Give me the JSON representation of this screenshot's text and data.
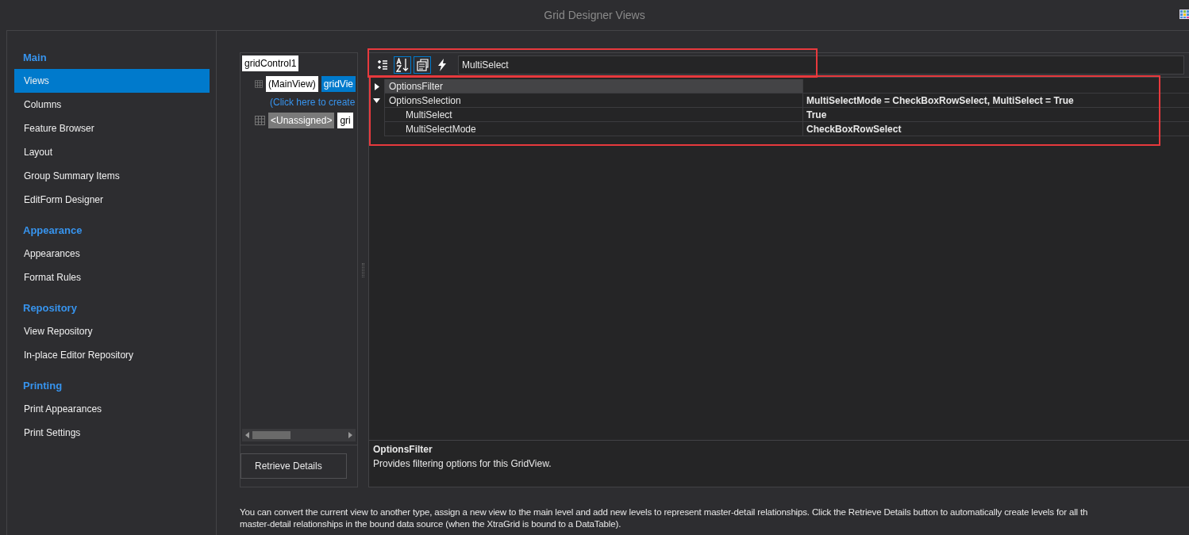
{
  "window": {
    "title": "Grid Designer Views"
  },
  "sidebar": {
    "groups": [
      {
        "title": "Main",
        "items": [
          {
            "label": "Views",
            "selected": true
          },
          {
            "label": "Columns",
            "selected": false
          },
          {
            "label": "Feature Browser",
            "selected": false
          },
          {
            "label": "Layout",
            "selected": false
          },
          {
            "label": "Group Summary Items",
            "selected": false
          },
          {
            "label": "EditForm Designer",
            "selected": false
          }
        ]
      },
      {
        "title": "Appearance",
        "items": [
          {
            "label": "Appearances",
            "selected": false
          },
          {
            "label": "Format Rules",
            "selected": false
          }
        ]
      },
      {
        "title": "Repository",
        "items": [
          {
            "label": "View Repository",
            "selected": false
          },
          {
            "label": "In-place Editor Repository",
            "selected": false
          }
        ]
      },
      {
        "title": "Printing",
        "items": [
          {
            "label": "Print Appearances",
            "selected": false
          },
          {
            "label": "Print Settings",
            "selected": false
          }
        ]
      }
    ]
  },
  "level_tree": {
    "root": "gridControl1",
    "rows": [
      {
        "kind": "level",
        "level": "(MainView)",
        "view": "gridVie",
        "view_selected": true
      },
      {
        "kind": "link",
        "text": "(Click here to create"
      },
      {
        "kind": "level",
        "level": "<Unassigned>",
        "view": "gri",
        "view_selected": false
      }
    ]
  },
  "retrieve_button": "Retrieve Details",
  "property_grid": {
    "toolbar": [
      {
        "kind": "categorized",
        "selected": false
      },
      {
        "kind": "alphabetical",
        "selected": true
      },
      {
        "kind": "pages",
        "selected": true
      },
      {
        "kind": "events",
        "selected": false
      }
    ],
    "search": {
      "value": "MultiSelect"
    },
    "rows": [
      {
        "name": "OptionsFilter",
        "value": "",
        "expanded": false,
        "selected": true,
        "children": []
      },
      {
        "name": "OptionsSelection",
        "value": "MultiSelectMode = CheckBoxRowSelect, MultiSelect = True",
        "expanded": true,
        "selected": false,
        "children": [
          {
            "name": "MultiSelect",
            "value": "True",
            "selected": false
          },
          {
            "name": "MultiSelectMode",
            "value": "CheckBoxRowSelect",
            "selected": false
          }
        ]
      }
    ],
    "description": {
      "title": "OptionsFilter",
      "text": "Provides filtering options for this GridView."
    }
  },
  "footer_lines": [
    "You can convert the current view to another type, assign a new view to the main level and add new levels to represent master-detail relationships. Click the Retrieve Details button to automatically create levels for all th",
    "master-detail relationships in the bound data source (when the XtraGrid is bound to a DataTable)."
  ]
}
